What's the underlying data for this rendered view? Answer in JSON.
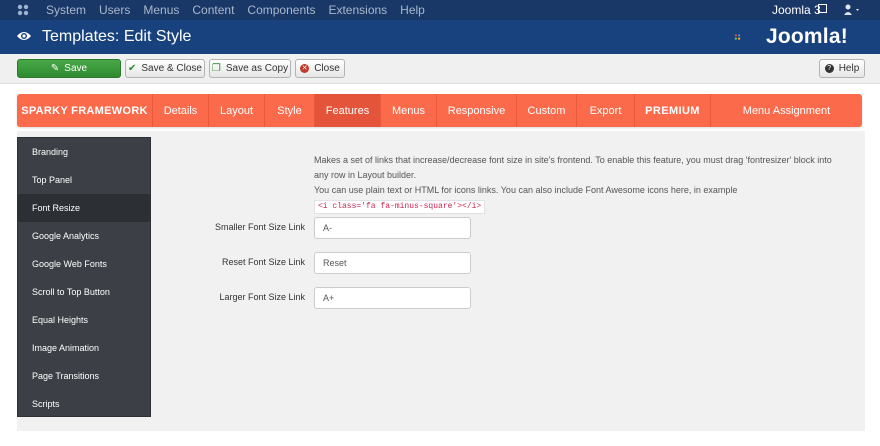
{
  "topbar": {
    "menu": [
      "System",
      "Users",
      "Menus",
      "Content",
      "Components",
      "Extensions",
      "Help"
    ],
    "site_link": "Joomla 3"
  },
  "header": {
    "title": "Templates: Edit Style",
    "brand": "Joomla!"
  },
  "toolbar": {
    "save": "Save",
    "save_close": "Save & Close",
    "save_copy": "Save as Copy",
    "close": "Close",
    "help": "Help"
  },
  "tabs": [
    "SPARKY FRAMEWORK",
    "Details",
    "Layout",
    "Style",
    "Features",
    "Menus",
    "Responsive",
    "Custom",
    "Export",
    "PREMIUM",
    "Menu Assignment"
  ],
  "active_tab": "Features",
  "sidebar": {
    "items": [
      "Branding",
      "Top Panel",
      "Font Resize",
      "Google Analytics",
      "Google Web Fonts",
      "Scroll to Top Button",
      "Equal Heights",
      "Image Animation",
      "Page Transitions",
      "Scripts"
    ],
    "active": "Font Resize"
  },
  "content": {
    "description_1": "Makes a set of links that increase/decrease font size in site's frontend. To enable this feature, you must drag 'fontresizer' block into any row in Layout builder.",
    "description_2": "You can use plain text or HTML for icons links. You can also include Font Awesome icons here, in example",
    "code_example": "<i class='fa fa-minus-square'></i>",
    "fields": [
      {
        "label": "Smaller Font Size Link",
        "value": "A-"
      },
      {
        "label": "Reset Font Size Link",
        "value": "Reset"
      },
      {
        "label": "Larger Font Size Link",
        "value": "A+"
      }
    ]
  },
  "colors": {
    "topbar": "#1a3867",
    "titlebar": "#17427e",
    "tabs": "#fb6a4b",
    "tab_active": "#e4543a",
    "save_button": "#3c9a3c",
    "sidebar": "#3c4046"
  }
}
